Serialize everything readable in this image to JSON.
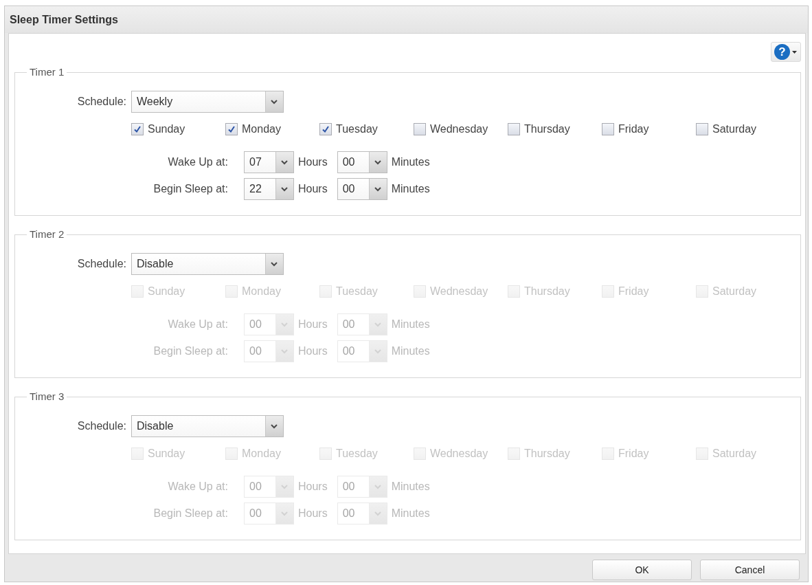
{
  "dialog": {
    "title": "Sleep Timer Settings"
  },
  "help_button": {
    "symbol": "?"
  },
  "timers": [
    {
      "legend": "Timer 1",
      "schedule": {
        "label": "Schedule:",
        "value": "Weekly"
      },
      "days": [
        {
          "label": "Sunday",
          "checked": true,
          "disabled": false
        },
        {
          "label": "Monday",
          "checked": true,
          "disabled": false
        },
        {
          "label": "Tuesday",
          "checked": true,
          "disabled": false
        },
        {
          "label": "Wednesday",
          "checked": false,
          "disabled": false
        },
        {
          "label": "Thursday",
          "checked": false,
          "disabled": false
        },
        {
          "label": "Friday",
          "checked": false,
          "disabled": false
        },
        {
          "label": "Saturday",
          "checked": false,
          "disabled": false
        }
      ],
      "times": [
        {
          "label": "Wake Up at:",
          "hours": "07",
          "hours_unit": "Hours",
          "minutes": "00",
          "minutes_unit": "Minutes",
          "disabled": false
        },
        {
          "label": "Begin Sleep at:",
          "hours": "22",
          "hours_unit": "Hours",
          "minutes": "00",
          "minutes_unit": "Minutes",
          "disabled": false
        }
      ]
    },
    {
      "legend": "Timer 2",
      "schedule": {
        "label": "Schedule:",
        "value": "Disable"
      },
      "days": [
        {
          "label": "Sunday",
          "checked": false,
          "disabled": true
        },
        {
          "label": "Monday",
          "checked": false,
          "disabled": true
        },
        {
          "label": "Tuesday",
          "checked": false,
          "disabled": true
        },
        {
          "label": "Wednesday",
          "checked": false,
          "disabled": true
        },
        {
          "label": "Thursday",
          "checked": false,
          "disabled": true
        },
        {
          "label": "Friday",
          "checked": false,
          "disabled": true
        },
        {
          "label": "Saturday",
          "checked": false,
          "disabled": true
        }
      ],
      "times": [
        {
          "label": "Wake Up at:",
          "hours": "00",
          "hours_unit": "Hours",
          "minutes": "00",
          "minutes_unit": "Minutes",
          "disabled": true
        },
        {
          "label": "Begin Sleep at:",
          "hours": "00",
          "hours_unit": "Hours",
          "minutes": "00",
          "minutes_unit": "Minutes",
          "disabled": true
        }
      ]
    },
    {
      "legend": "Timer 3",
      "schedule": {
        "label": "Schedule:",
        "value": "Disable"
      },
      "days": [
        {
          "label": "Sunday",
          "checked": false,
          "disabled": true
        },
        {
          "label": "Monday",
          "checked": false,
          "disabled": true
        },
        {
          "label": "Tuesday",
          "checked": false,
          "disabled": true
        },
        {
          "label": "Wednesday",
          "checked": false,
          "disabled": true
        },
        {
          "label": "Thursday",
          "checked": false,
          "disabled": true
        },
        {
          "label": "Friday",
          "checked": false,
          "disabled": true
        },
        {
          "label": "Saturday",
          "checked": false,
          "disabled": true
        }
      ],
      "times": [
        {
          "label": "Wake Up at:",
          "hours": "00",
          "hours_unit": "Hours",
          "minutes": "00",
          "minutes_unit": "Minutes",
          "disabled": true
        },
        {
          "label": "Begin Sleep at:",
          "hours": "00",
          "hours_unit": "Hours",
          "minutes": "00",
          "minutes_unit": "Minutes",
          "disabled": true
        }
      ]
    }
  ],
  "buttons": [
    "OK",
    "Cancel"
  ]
}
